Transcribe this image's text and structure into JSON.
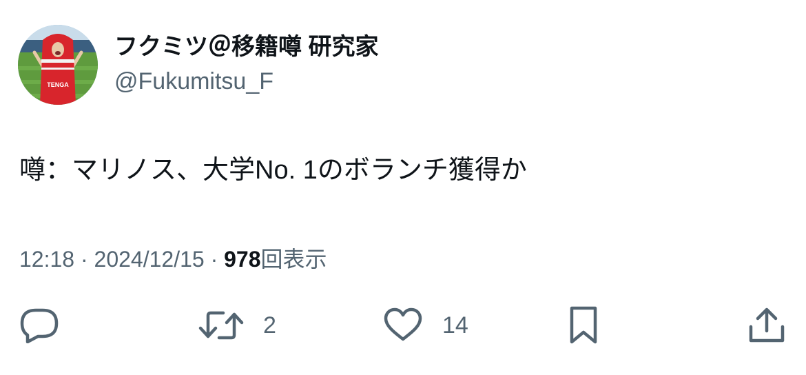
{
  "user": {
    "display_name": "フクミツ＠移籍噂 研究家",
    "handle": "@Fukumitsu_F",
    "avatar_text": "TENGA"
  },
  "tweet": {
    "text": "噂：マリノス、大学No. 1のボランチ獲得か"
  },
  "meta": {
    "time": "12:18",
    "separator": " · ",
    "date": "2024/12/15",
    "views_count": "978",
    "views_label": "回表示"
  },
  "actions": {
    "retweet_count": "2",
    "like_count": "14"
  },
  "icons": {
    "reply": "reply-icon",
    "retweet": "retweet-icon",
    "like": "heart-icon",
    "bookmark": "bookmark-icon",
    "share": "share-icon"
  },
  "colors": {
    "text": "#0f1419",
    "secondary": "#536471",
    "avatar_red": "#d8252c",
    "avatar_grass": "#5f9b3e"
  }
}
